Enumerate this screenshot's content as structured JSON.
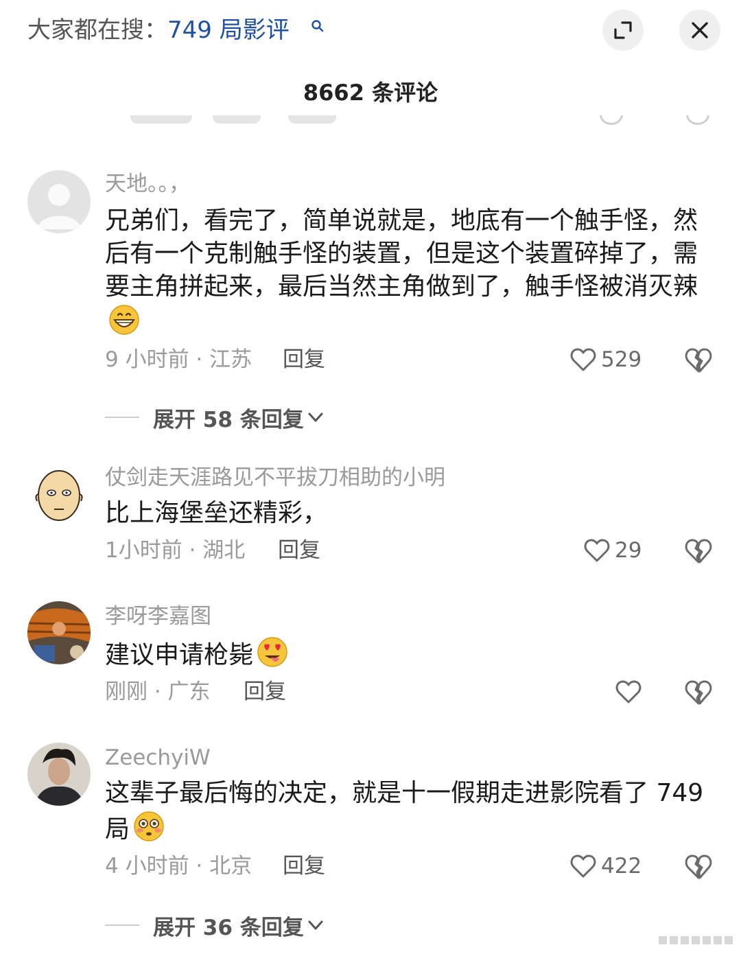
{
  "header": {
    "search_prefix": "大家都在搜：",
    "search_query": "749 局影评",
    "icons": [
      "search-icon",
      "expand-icon",
      "close-icon"
    ]
  },
  "panel": {
    "title": "8662 条评论"
  },
  "comments": [
    {
      "username": "天地。。，",
      "text": "兄弟们，看完了，简单说就是，地底有一个触手怪，然后有一个克制触手怪的装置，但是这个装置碎掉了，需要主角拼起来，最后当然主角做到了，触手怪被消灭辣",
      "emoji": "grinning-face-emoji",
      "meta": "9 小时前 · 江苏",
      "reply_label": "回复",
      "likes": "529",
      "expand_label": "展开 58 条回复"
    },
    {
      "username": "仗剑走天涯路见不平拔刀相助的小明",
      "text": "比上海堡垒还精彩，",
      "meta": "1小时前 · 湖北",
      "reply_label": "回复",
      "likes": "29"
    },
    {
      "username": "李呀李嘉图",
      "text": "建议申请枪毙",
      "emoji": "heart-eyes-tongue-emoji",
      "meta": "刚刚 · 广东",
      "reply_label": "回复",
      "likes": ""
    },
    {
      "username": "ZeechyiW",
      "text": "这辈子最后悔的决定，就是十一假期走进影院看了 749 局",
      "emoji": "flushed-face-emoji",
      "meta": "4 小时前 · 北京",
      "reply_label": "回复",
      "likes": "422",
      "expand_label": "展开 36 条回复"
    }
  ]
}
